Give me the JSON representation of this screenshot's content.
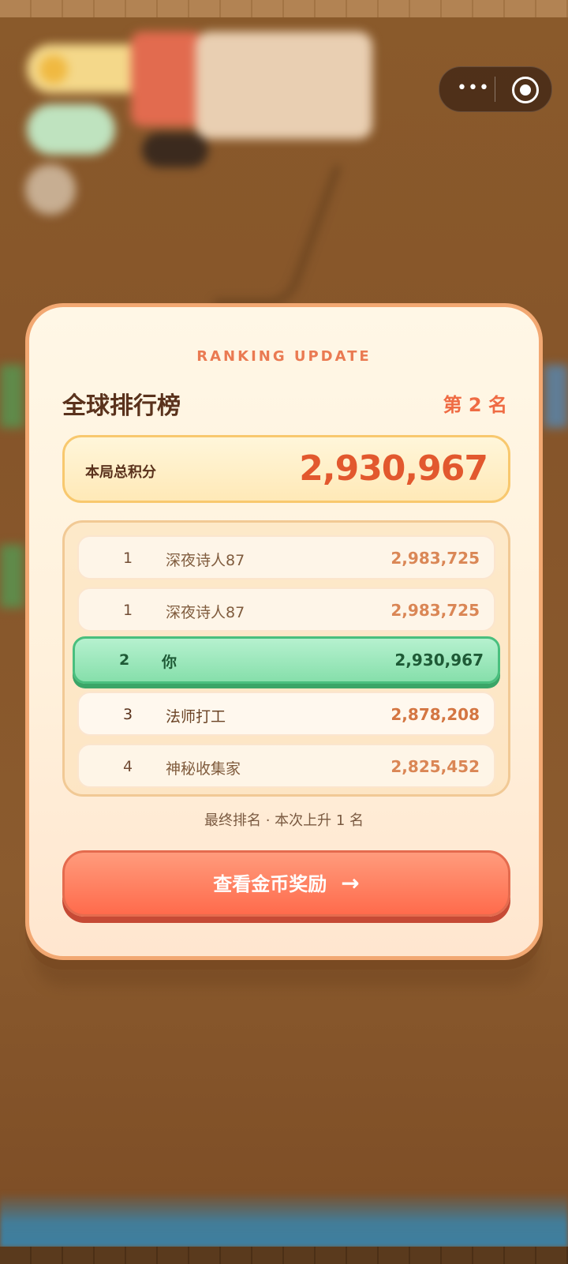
{
  "capsule": {
    "more_glyph": "•••"
  },
  "modal": {
    "kicker": "RANKING UPDATE",
    "title": "全球排行榜",
    "rank_badge": "第 2 名",
    "score_label": "本局总积分",
    "score_value": "2,930,967",
    "rows": [
      {
        "rank": "1",
        "name": "深夜诗人87",
        "score": "2,983,725"
      },
      {
        "rank": "1",
        "name": "深夜诗人87",
        "score": "2,983,725"
      },
      {
        "rank": "2",
        "name": "你",
        "score": "2,930,967"
      },
      {
        "rank": "3",
        "name": "法师打工",
        "score": "2,878,208"
      },
      {
        "rank": "4",
        "name": "神秘收集家",
        "score": "2,825,452"
      }
    ],
    "footnote": "最终排名 · 本次上升 1 名",
    "cta_label": "查看金币奖励",
    "cta_arrow": "→"
  },
  "colors": {
    "accent": "#ef6b43",
    "highlight_row": "#86dfab",
    "cta": "#ff6b4c"
  }
}
